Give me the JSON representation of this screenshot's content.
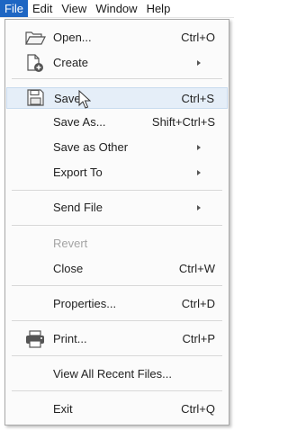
{
  "menubar": {
    "items": [
      "File",
      "Edit",
      "View",
      "Window",
      "Help"
    ],
    "active_item": "File"
  },
  "file_menu": {
    "open": {
      "label": "Open...",
      "shortcut": "Ctrl+O",
      "icon": "folder-open-icon"
    },
    "create": {
      "label": "Create",
      "icon": "create-pdf-icon"
    },
    "save": {
      "label": "Save",
      "shortcut": "Ctrl+S",
      "icon": "floppy-disk-icon"
    },
    "save_as": {
      "label": "Save As...",
      "shortcut": "Shift+Ctrl+S"
    },
    "save_as_other": {
      "label": "Save as Other"
    },
    "export_to": {
      "label": "Export To"
    },
    "send_file": {
      "label": "Send File"
    },
    "revert": {
      "label": "Revert",
      "disabled": true
    },
    "close": {
      "label": "Close",
      "shortcut": "Ctrl+W"
    },
    "properties": {
      "label": "Properties...",
      "shortcut": "Ctrl+D"
    },
    "print": {
      "label": "Print...",
      "shortcut": "Ctrl+P",
      "icon": "printer-icon"
    },
    "view_all_recent": {
      "label": "View All Recent Files..."
    },
    "exit": {
      "label": "Exit",
      "shortcut": "Ctrl+Q"
    }
  },
  "colors": {
    "menubar_active_bg": "#1e66c3",
    "hover_bg": "#e5eef8",
    "menu_bg": "#fbfbfb",
    "disabled_text": "#a4a4a4"
  }
}
